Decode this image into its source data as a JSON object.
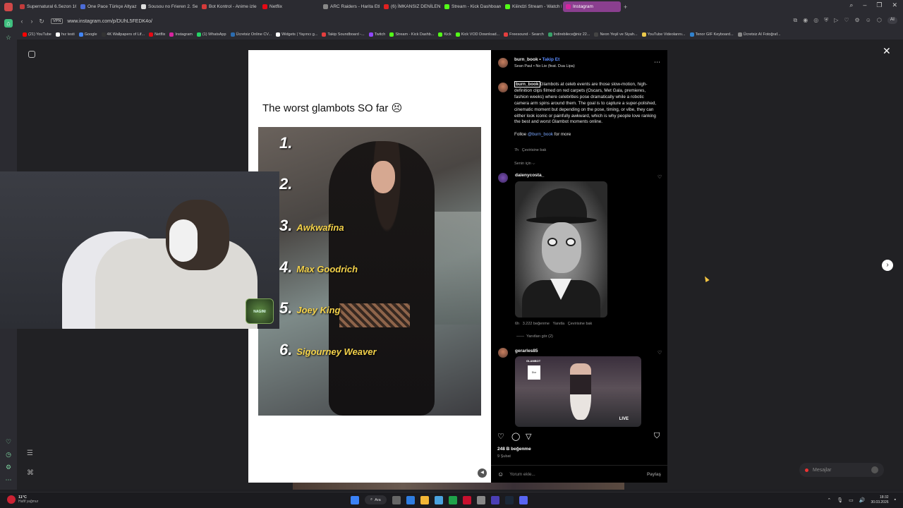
{
  "browser": {
    "tabs": [
      {
        "label": "Supernatural 6.Sezon 16.B",
        "color": "#c23b3b"
      },
      {
        "label": "One Pace Türkçe Altyazılı",
        "color": "#4b6bd6"
      },
      {
        "label": "Sousou no Frieren 2. Sezo",
        "color": "#dddddd"
      },
      {
        "label": "Bot Kontrol - Anime izle",
        "color": "#d43a3a"
      },
      {
        "label": "Netflix",
        "color": "#e50914"
      },
      {
        "label": "ARC Raiders - Harita Etkil",
        "color": "#888888"
      },
      {
        "label": "(6) İMKANSIZ DENİLEN M",
        "color": "#e02020"
      },
      {
        "label": "Stream - Kick Dashboard",
        "color": "#53fc18"
      },
      {
        "label": "Kiiindzi Stream - Watch Li",
        "color": "#53fc18"
      },
      {
        "label": "Instagram",
        "color": "#d6249f"
      }
    ],
    "active_tab": "Instagram",
    "url": "www.instagram.com/p/DUhL5FEDK4o/",
    "vpn_label": "VPN",
    "ai_label": "AI",
    "bookmarks": [
      {
        "label": "(21) YouTube",
        "color": "#ff0000"
      },
      {
        "label": "hız testi",
        "color": "#ffffff"
      },
      {
        "label": "Google",
        "color": "#4285f4"
      },
      {
        "label": "4K Wallpapers of Lif...",
        "color": "#333333"
      },
      {
        "label": "Netflix",
        "color": "#e50914"
      },
      {
        "label": "Instagram",
        "color": "#d6249f"
      },
      {
        "label": "(1) WhatsApp",
        "color": "#25d366"
      },
      {
        "label": "Ücretsiz Online CV...",
        "color": "#2b6cb0"
      },
      {
        "label": "Widgets | Yayıncı g...",
        "color": "#ffffff"
      },
      {
        "label": "Takip Soundboard -...",
        "color": "#e53e3e"
      },
      {
        "label": "Twitch",
        "color": "#9146ff"
      },
      {
        "label": "Stream - Kick Dashb...",
        "color": "#53fc18"
      },
      {
        "label": "Kick",
        "color": "#53fc18"
      },
      {
        "label": "Kick VOD Download...",
        "color": "#53fc18"
      },
      {
        "label": "Freesound - Search",
        "color": "#e53e3e"
      },
      {
        "label": "İndirebileceğiniz 22...",
        "color": "#38a169"
      },
      {
        "label": "Neon Yeşil ve Siyah...",
        "color": "#444444"
      },
      {
        "label": "YouTube Videolarını...",
        "color": "#ecc94b"
      },
      {
        "label": "Tenor GIF Keyboard...",
        "color": "#3182ce"
      },
      {
        "label": "Ücretsiz AI Fotoğraf...",
        "color": "#888888"
      }
    ]
  },
  "post": {
    "heading": "The worst glambots SO far 😣",
    "ranks": [
      {
        "num": "1.",
        "name": ""
      },
      {
        "num": "2.",
        "name": ""
      },
      {
        "num": "3.",
        "name": "Awkwafina"
      },
      {
        "num": "4.",
        "name": "Max Goodrich"
      },
      {
        "num": "5.",
        "name": "Joey King"
      },
      {
        "num": "6.",
        "name": "Sigourney Weaver"
      }
    ]
  },
  "webcam": {
    "badge": "NAGINI"
  },
  "panel": {
    "username": "burn_book",
    "follow": "Takip Et",
    "song": "Sean Paul • No Lie (feat. Dua Lipa)",
    "caption_user": "burn_book",
    "caption": "Glambots at celeb events are those slow-motion, high-definition clips filmed on red carpets (Oscars, Met Gala, premieres, fashion weeks) where celebrities pose dramatically while a robotic camera arm spins around them. The goal is to capture a super-polished, cinematic moment but depending on the pose, timing, or vibe, they can either look iconic or painfully awkward, which is why people love ranking the best and worst Glambot moments online.",
    "follow_line_pre": "Folloe ",
    "follow_line_mention": "@burn_book",
    "follow_line_post": " for more",
    "caption_meta_time": "7h",
    "caption_meta_translate": "Çevirisine bak",
    "for_you": "Senin için ⌵",
    "comments": [
      {
        "user": "daienycosta_",
        "time": "6h",
        "likes": "3.222 beğenme",
        "reply": "Yanıtla",
        "translate": "Çevirisine bak",
        "view_replies": "Yanıtları gör (2)"
      },
      {
        "user": "gerarles85",
        "glambot_label": "GLAMBOT",
        "dior": "Dior",
        "live": "LIVE"
      }
    ],
    "likes": "248 B beğenme",
    "date": "9 Şubat",
    "comment_placeholder": "Yorum ekle...",
    "share": "Paylaş"
  },
  "messages": {
    "label": "Mesajlar"
  },
  "taskbar": {
    "weather_temp": "11°C",
    "weather_desc": "Hafif yağmur",
    "search": "Ara",
    "time": "18:32",
    "date": "30.03.2026"
  }
}
